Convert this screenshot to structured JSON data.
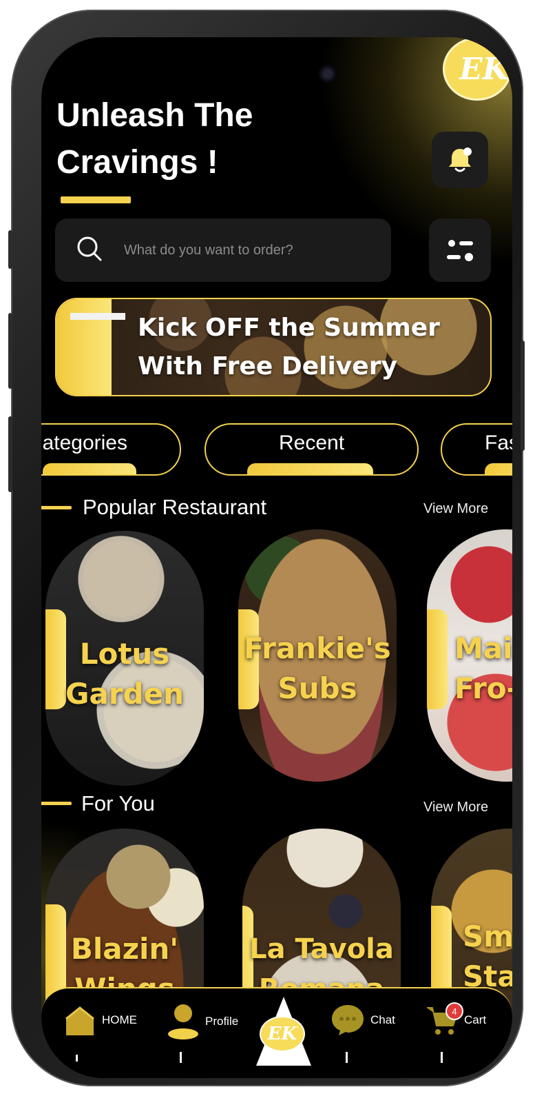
{
  "header": {
    "title_line1": "Unleash The",
    "title_line2": "Cravings !",
    "logo_text": "EK"
  },
  "search": {
    "placeholder": "What do you want to order?"
  },
  "promo": {
    "line1": "Kick OFF the Summer",
    "line2": "With Free Delivery"
  },
  "tabs": [
    {
      "label": "ategories"
    },
    {
      "label": "Recent"
    },
    {
      "label": "Fas"
    }
  ],
  "popular": {
    "title": "Popular Restaurant",
    "view_more": "View More",
    "cards": [
      {
        "line1": "Lotus",
        "line2": "Garden"
      },
      {
        "line1": "Frankie's",
        "line2": "Subs"
      },
      {
        "line1": "Mair",
        "line2": "Fro-"
      }
    ]
  },
  "for_you": {
    "title": "For You",
    "view_more": "View More",
    "cards": [
      {
        "line1": "Blazin'",
        "line2": "Wings"
      },
      {
        "line1": "La Tavola",
        "line2": "Romana"
      },
      {
        "line1": "Smo",
        "line2": "Sta"
      }
    ]
  },
  "nav": {
    "home": "HOME",
    "profile": "Profile",
    "center": "EK",
    "chat": "Chat",
    "cart": "Cart",
    "cart_count": "4"
  },
  "colors": {
    "accent": "#f6d24e",
    "background": "#000000",
    "badge": "#e23a3a"
  }
}
